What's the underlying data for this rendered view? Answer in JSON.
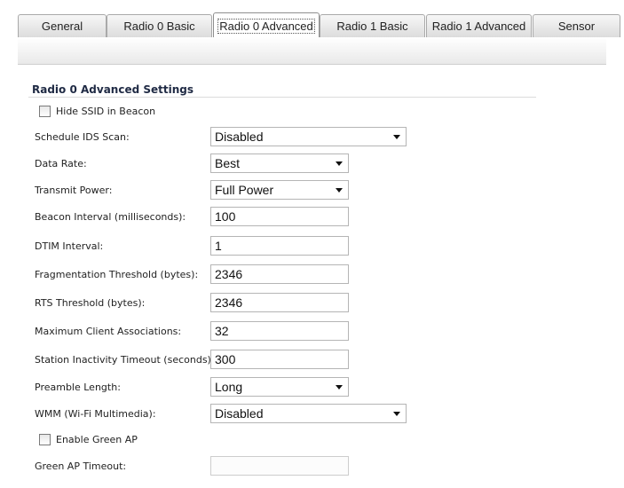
{
  "tabs": [
    {
      "label": "General"
    },
    {
      "label": "Radio 0 Basic"
    },
    {
      "label": "Radio 0 Advanced"
    },
    {
      "label": "Radio 1 Basic"
    },
    {
      "label": "Radio 1 Advanced"
    },
    {
      "label": "Sensor"
    }
  ],
  "active_tab": "Radio 0 Advanced",
  "section": {
    "title": "Radio 0 Advanced Settings"
  },
  "hide_ssid": {
    "label": "Hide SSID in Beacon",
    "checked": false
  },
  "schedule_ids": {
    "label": "Schedule IDS Scan:",
    "value": "Disabled"
  },
  "data_rate": {
    "label": "Data Rate:",
    "value": "Best"
  },
  "transmit_power": {
    "label": "Transmit Power:",
    "value": "Full Power"
  },
  "beacon_interval": {
    "label": "Beacon Interval (milliseconds):",
    "value": "100"
  },
  "dtim_interval": {
    "label": "DTIM Interval:",
    "value": "1"
  },
  "frag_threshold": {
    "label": "Fragmentation Threshold (bytes):",
    "value": "2346"
  },
  "rts_threshold": {
    "label": "RTS Threshold (bytes):",
    "value": "2346"
  },
  "max_clients": {
    "label": "Maximum Client Associations:",
    "value": "32"
  },
  "inactivity_timeout": {
    "label": "Station Inactivity Timeout (seconds):",
    "value": "300"
  },
  "preamble": {
    "label": "Preamble Length:",
    "value": "Long"
  },
  "wmm": {
    "label": "WMM (Wi-Fi Multimedia):",
    "value": "Disabled"
  },
  "green_ap": {
    "label": "Enable Green AP",
    "checked": false
  },
  "green_ap_timeout": {
    "label": "Green AP Timeout:",
    "value": ""
  }
}
